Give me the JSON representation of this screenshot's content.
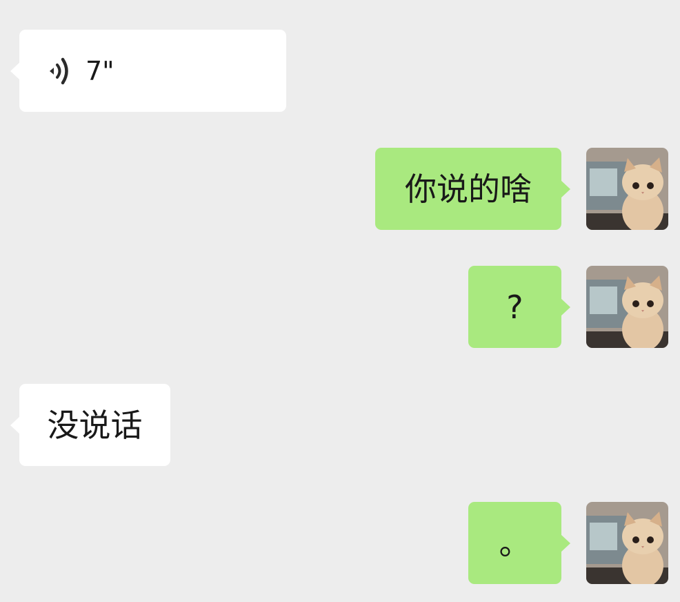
{
  "messages": [
    {
      "side": "in",
      "kind": "voice",
      "duration": "7\"",
      "icon": "voice-wave-icon"
    },
    {
      "side": "out",
      "kind": "text",
      "text": "你说的啥"
    },
    {
      "side": "out",
      "kind": "text",
      "text": "?"
    },
    {
      "side": "in",
      "kind": "text",
      "text": "没说话"
    },
    {
      "side": "out",
      "kind": "text",
      "text": "。"
    }
  ],
  "colors": {
    "background": "#ededed",
    "incoming_bubble": "#ffffff",
    "outgoing_bubble": "#a9e97f",
    "text": "#191919"
  },
  "avatar": {
    "icon": "cat-avatar"
  }
}
